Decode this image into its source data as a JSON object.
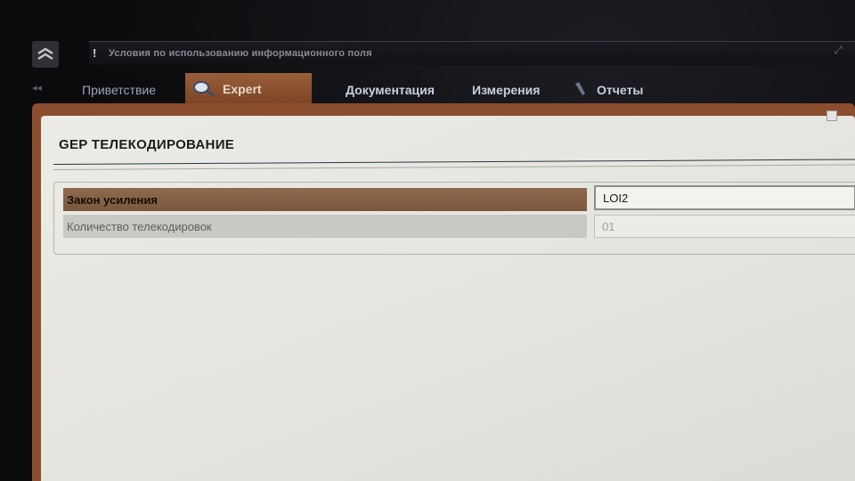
{
  "top_bar": {
    "info_icon": "!",
    "info_text": "Условия по использованию информационного поля"
  },
  "tabs": [
    {
      "label": "Приветствие",
      "active": false
    },
    {
      "label": "Expert",
      "active": true,
      "icon": "magnifier-icon"
    },
    {
      "label": "Документация",
      "active": false
    },
    {
      "label": "Измерения",
      "active": false
    },
    {
      "label": "Отчеты",
      "active": false,
      "icon": "pen-icon"
    }
  ],
  "page": {
    "title": "GEP  ТЕЛЕКОДИРОВАНИЕ"
  },
  "parameters": [
    {
      "label": "Закон усиления",
      "value": "LOI2",
      "selected": true
    },
    {
      "label": "Количество телекодировок",
      "value": "01",
      "selected": false
    }
  ],
  "colors": {
    "accent": "#8a4e2e",
    "selected_row": "#8e6a4e",
    "panel_bg": "#ecebe6"
  }
}
